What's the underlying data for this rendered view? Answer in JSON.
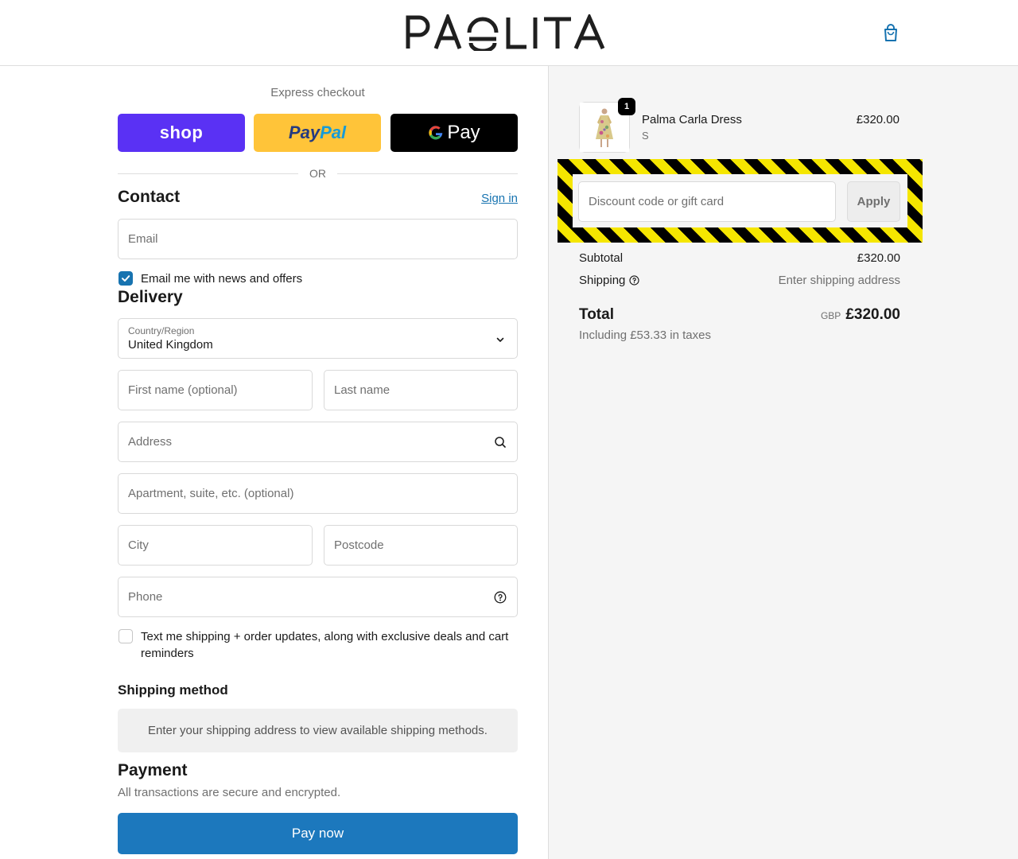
{
  "brand": {
    "name": "PAOLITA"
  },
  "express": {
    "label": "Express checkout",
    "shop_label": "shop",
    "paypal_pay": "Pay",
    "paypal_pal": "Pal",
    "gpay_label": "Pay",
    "or_label": "OR"
  },
  "contact": {
    "title": "Contact",
    "signin_label": "Sign in",
    "email_placeholder": "Email",
    "newsletter_label": "Email me with news and offers",
    "newsletter_checked": true
  },
  "delivery": {
    "title": "Delivery",
    "country_label": "Country/Region",
    "country_value": "United Kingdom",
    "first_name_placeholder": "First name (optional)",
    "last_name_placeholder": "Last name",
    "address_placeholder": "Address",
    "apartment_placeholder": "Apartment, suite, etc. (optional)",
    "city_placeholder": "City",
    "postcode_placeholder": "Postcode",
    "phone_placeholder": "Phone",
    "sms_label": "Text me shipping + order updates, along with exclusive deals and cart reminders",
    "sms_checked": false
  },
  "shipping_method": {
    "title": "Shipping method",
    "message": "Enter your shipping address to view available shipping methods."
  },
  "payment": {
    "title": "Payment",
    "subtitle": "All transactions are secure and encrypted.",
    "pay_button": "Pay now"
  },
  "summary": {
    "item": {
      "quantity": "1",
      "name": "Palma Carla Dress",
      "variant": "S",
      "price": "£320.00"
    },
    "discount_placeholder": "Discount code or gift card",
    "apply_label": "Apply",
    "subtotal_label": "Subtotal",
    "subtotal_value": "£320.00",
    "shipping_label": "Shipping",
    "shipping_value": "Enter shipping address",
    "total_label": "Total",
    "currency": "GBP",
    "total_value": "£320.00",
    "taxes_note": "Including £53.33 in taxes"
  },
  "colors": {
    "accent": "#1773b0",
    "pay_button": "#1c78bd",
    "shop_pay": "#5a31f4",
    "paypal": "#ffc439",
    "gpay": "#000000",
    "hazard_yellow": "#f5e600"
  },
  "icons": {
    "cart": "shopping-bag-icon",
    "select": "chevron-down-icon",
    "address": "search-icon",
    "phone": "help-circle-icon",
    "shipping": "help-circle-icon",
    "checkbox": "checkmark-icon",
    "gpay": "google-g-icon"
  }
}
